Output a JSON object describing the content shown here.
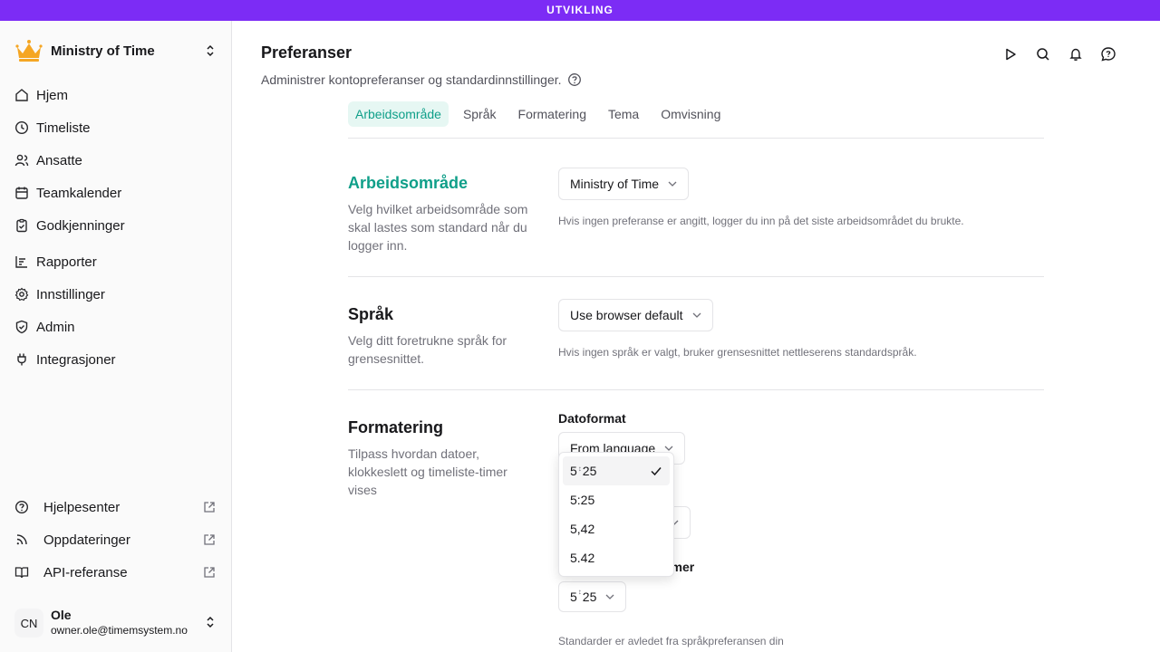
{
  "env_banner": "UTVIKLING",
  "workspace": {
    "name": "Ministry of Time"
  },
  "nav": [
    {
      "label": "Hjem",
      "icon": "home-icon"
    },
    {
      "label": "Timeliste",
      "icon": "clock-icon"
    },
    {
      "label": "Ansatte",
      "icon": "users-icon"
    },
    {
      "label": "Teamkalender",
      "icon": "calendar-icon"
    },
    {
      "label": "Godkjenninger",
      "icon": "clipboard-check-icon"
    },
    {
      "label": "Rapporter",
      "icon": "report-icon"
    },
    {
      "label": "Innstillinger",
      "icon": "gear-icon"
    },
    {
      "label": "Admin",
      "icon": "shield-icon"
    },
    {
      "label": "Integrasjoner",
      "icon": "plug-icon"
    }
  ],
  "bottom_links": [
    {
      "label": "Hjelpesenter",
      "icon": "help-icon"
    },
    {
      "label": "Oppdateringer",
      "icon": "rss-icon"
    },
    {
      "label": "API-referanse",
      "icon": "book-icon"
    }
  ],
  "user": {
    "initials": "CN",
    "name": "Ole",
    "email": "owner.ole@timemsystem.no"
  },
  "page": {
    "title": "Preferanser",
    "subtitle": "Administrer kontopreferanser og standardinnstillinger."
  },
  "tabs": [
    "Arbeidsområde",
    "Språk",
    "Formatering",
    "Tema",
    "Omvisning"
  ],
  "sections": {
    "workspace": {
      "title": "Arbeidsområde",
      "desc": "Velg hvilket arbeidsområde som skal lastes som standard når du logger inn.",
      "select_value": "Ministry of Time",
      "hint": "Hvis ingen preferanse er angitt, logger du inn på det siste arbeidsområdet du brukte."
    },
    "language": {
      "title": "Språk",
      "desc": "Velg ditt foretrukne språk for grensesnittet.",
      "select_value": "Use browser default",
      "hint": "Hvis ingen språk er valgt, bruker grensesnittet nettleserens standardspråk."
    },
    "formatting": {
      "title": "Formatering",
      "desc": "Tilpass hvordan datoer, klokkeslett og timeliste-timer vises",
      "date_label": "Datoformat",
      "date_value": "From language",
      "hours_label_tail": "timer",
      "hours_value_a": "5",
      "hours_value_b": "25",
      "hint": "Standarder er avledet fra språkpreferansen din"
    }
  },
  "dropdown_options": [
    {
      "a": "5",
      "b": "25",
      "special": true,
      "selected": true
    },
    {
      "label": "5:25"
    },
    {
      "label": "5,42"
    },
    {
      "label": "5.42"
    }
  ],
  "colors": {
    "banner": "#7c2cf5",
    "accent": "#0f9f89",
    "crown": "#f5a623"
  }
}
